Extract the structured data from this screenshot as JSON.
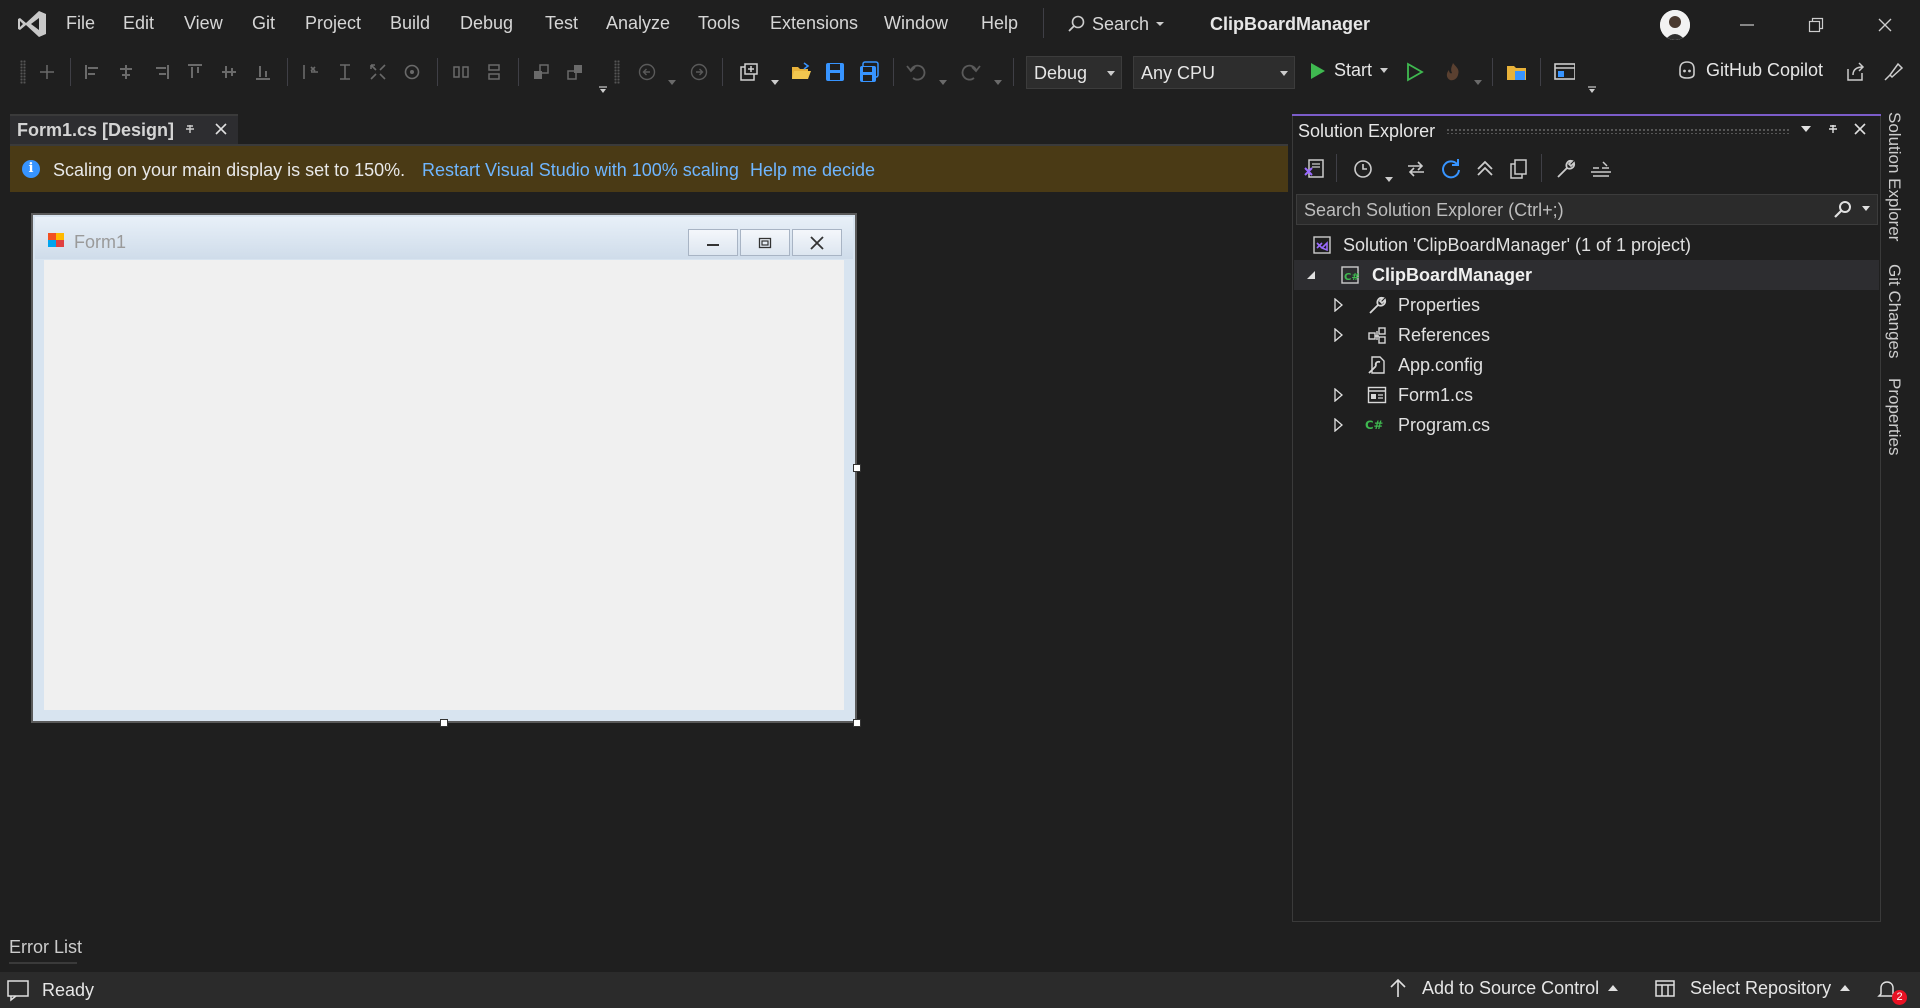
{
  "menu": {
    "items": [
      "File",
      "Edit",
      "View",
      "Git",
      "Project",
      "Build",
      "Debug",
      "Test",
      "Analyze",
      "Tools",
      "Extensions",
      "Window",
      "Help"
    ],
    "search_label": "Search",
    "app_title": "ClipBoardManager"
  },
  "toolbar": {
    "config": "Debug",
    "platform": "Any CPU",
    "start_label": "Start",
    "copilot_label": "GitHub Copilot"
  },
  "document": {
    "tab_label": "Form1.cs [Design]"
  },
  "infobar": {
    "message": "Scaling on your main display is set to 150%.",
    "restart_link": "Restart Visual Studio with 100% scaling",
    "help_link": "Help me decide"
  },
  "designer": {
    "form_title": "Form1"
  },
  "solution_explorer": {
    "title": "Solution Explorer",
    "search_placeholder": "Search Solution Explorer (Ctrl+;)",
    "solution_label": "Solution 'ClipBoardManager' (1 of 1 project)",
    "project_label": "ClipBoardManager",
    "items": [
      {
        "label": "Properties",
        "icon": "wrench-icon",
        "expandable": true
      },
      {
        "label": "References",
        "icon": "references-icon",
        "expandable": true
      },
      {
        "label": "App.config",
        "icon": "config-file-icon",
        "expandable": false
      },
      {
        "label": "Form1.cs",
        "icon": "form-icon",
        "expandable": true
      },
      {
        "label": "Program.cs",
        "icon": "csharp-file-icon",
        "expandable": true
      }
    ]
  },
  "side_tabs": [
    "Solution Explorer",
    "Git Changes",
    "Properties"
  ],
  "bottom": {
    "error_list": "Error List"
  },
  "status": {
    "ready": "Ready",
    "add_source_control": "Add to Source Control",
    "select_repository": "Select Repository",
    "notification_count": "2"
  },
  "colors": {
    "accent_purple": "#7b5cc9",
    "info_link": "#6fb6ff",
    "infobar_bg": "#4a3a15",
    "start_green": "#3fb950"
  }
}
